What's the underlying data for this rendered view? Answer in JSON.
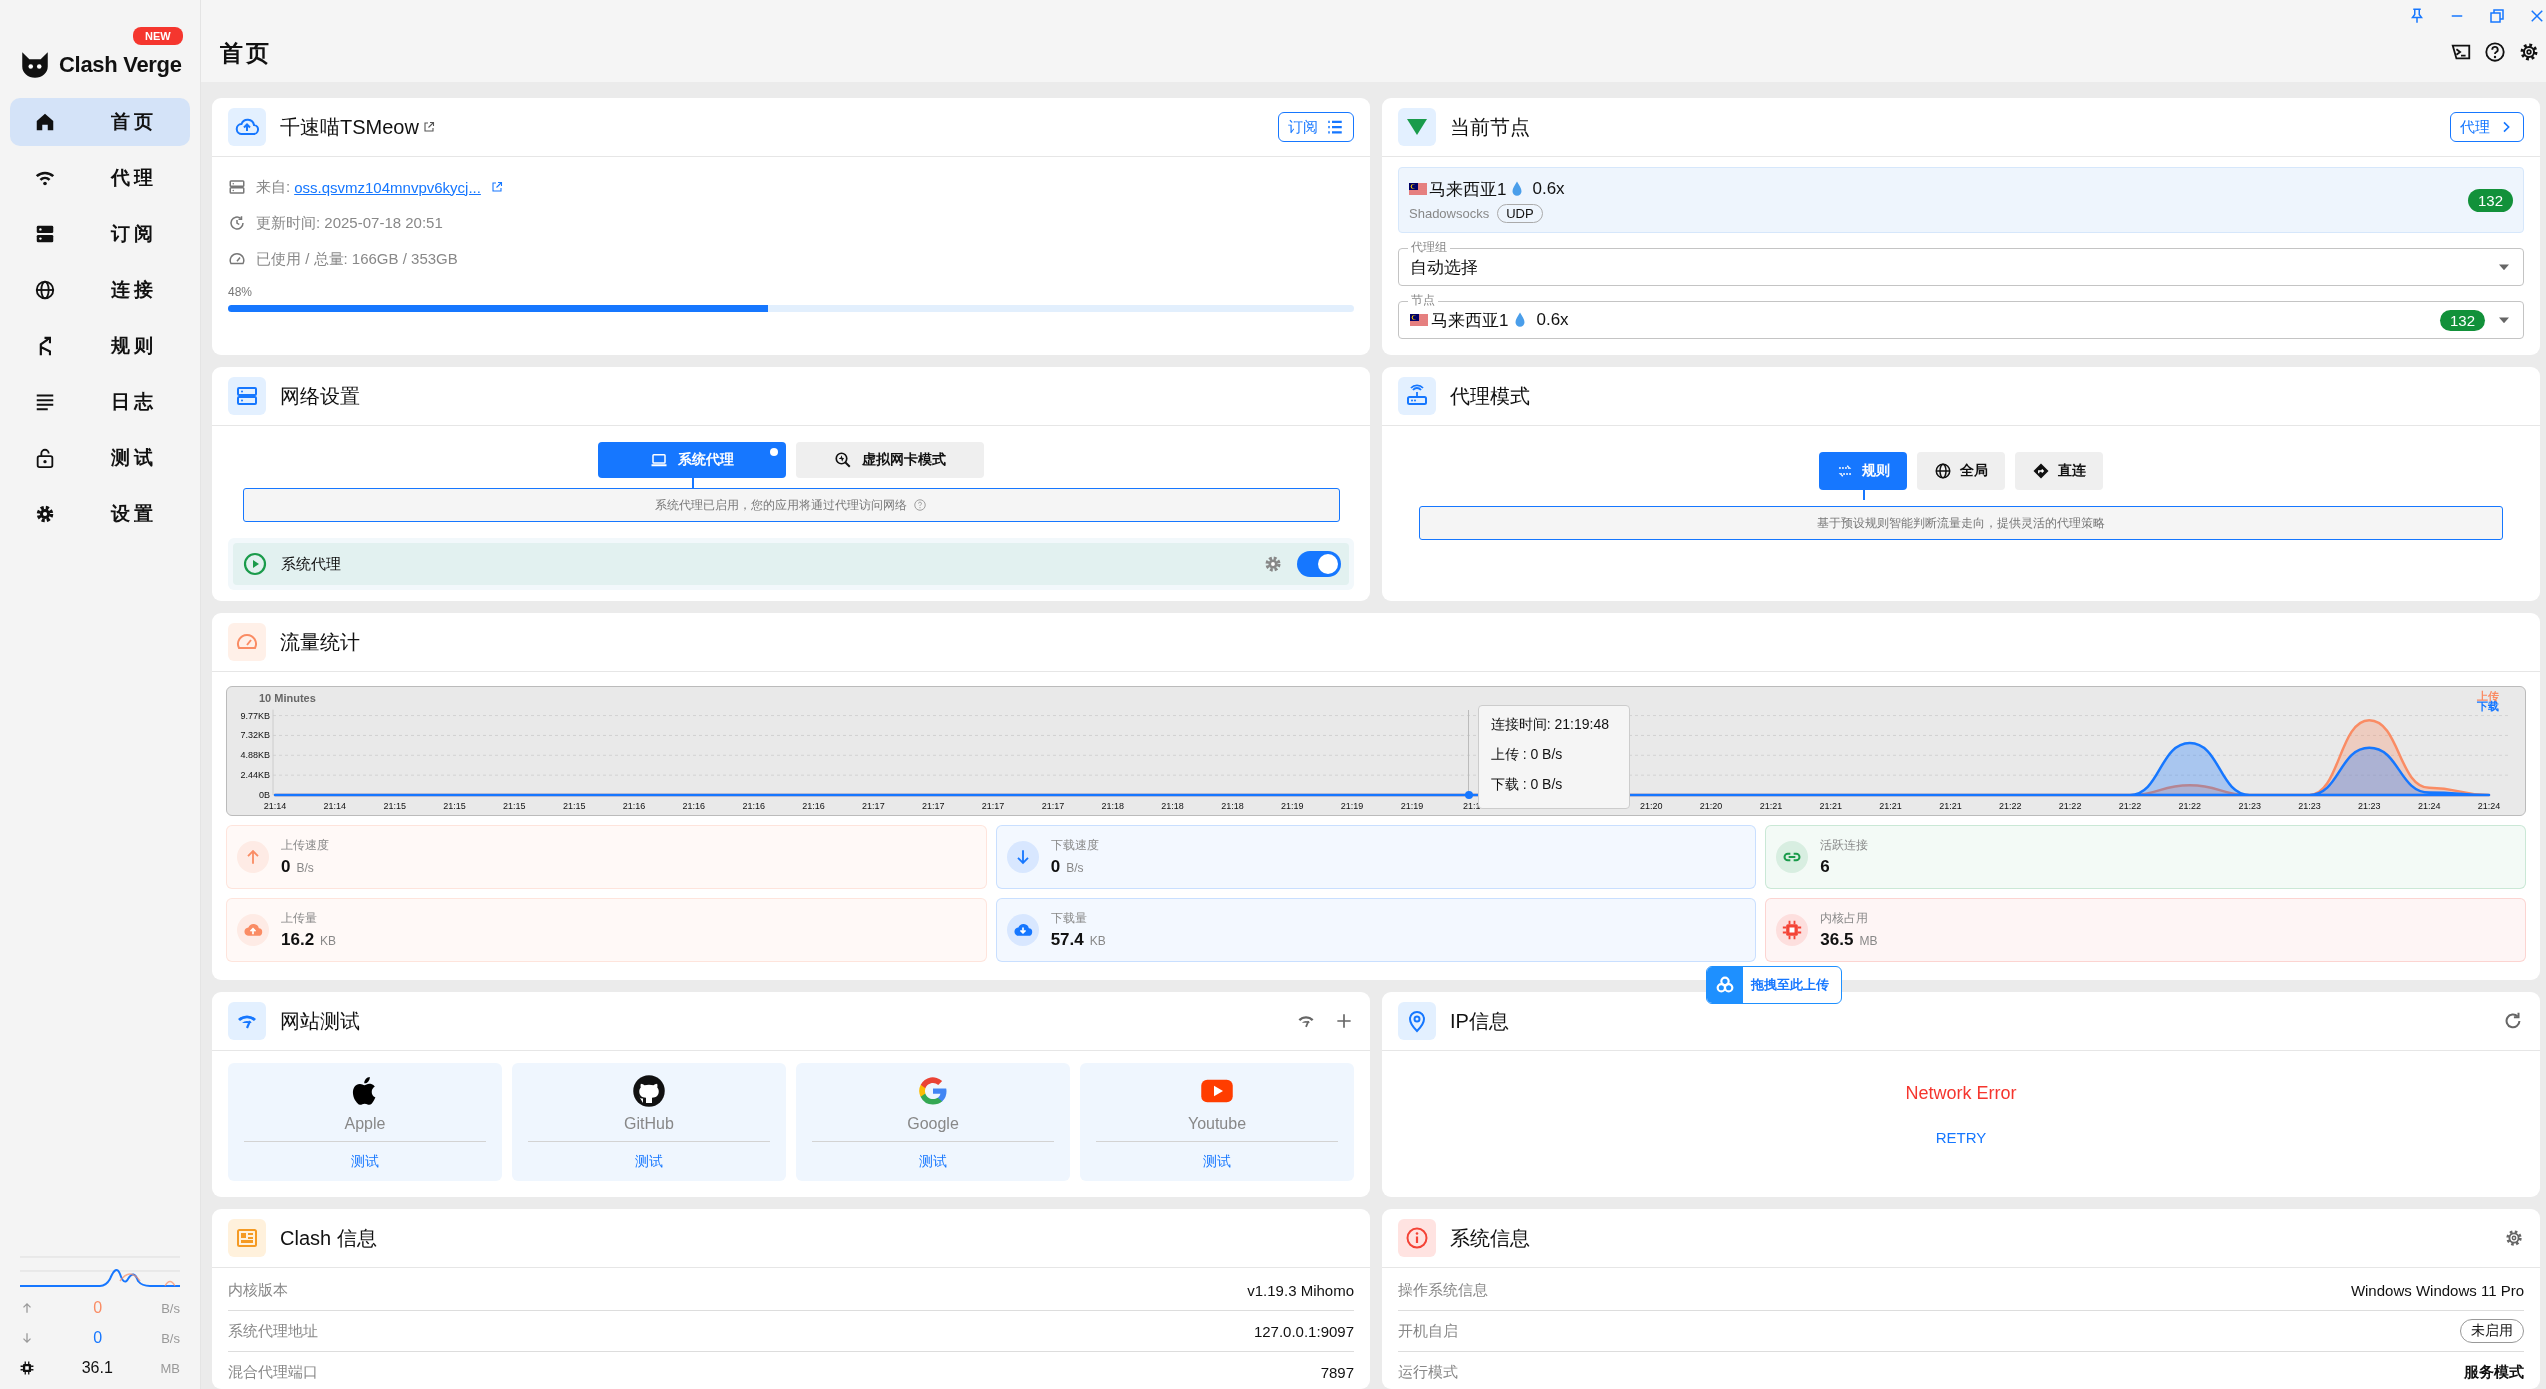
{
  "sidebar": {
    "logo": "Clash Verge",
    "badge": "NEW",
    "items": [
      {
        "label": "首页",
        "selected": true
      },
      {
        "label": "代理",
        "selected": false
      },
      {
        "label": "订阅",
        "selected": false
      },
      {
        "label": "连接",
        "selected": false
      },
      {
        "label": "规则",
        "selected": false
      },
      {
        "label": "日志",
        "selected": false
      },
      {
        "label": "测试",
        "selected": false
      },
      {
        "label": "设置",
        "selected": false
      }
    ],
    "traffic": [
      {
        "value": "0",
        "unit": "B/s"
      },
      {
        "value": "0",
        "unit": "B/s"
      },
      {
        "value": "36.1",
        "unit": "MB"
      }
    ]
  },
  "header": {
    "title": "首页"
  },
  "profile": {
    "name": "千速喵TSMeow",
    "button": "订阅",
    "source_label": "来自: ",
    "source_link": "oss.qsvmz104mnvpv6kycj...",
    "updated": "更新时间: 2025-07-18 20:51",
    "usage": "已使用 / 总量: 166GB / 353GB",
    "percent": "48%",
    "level": 0.48
  },
  "current_node": {
    "title": "当前节点",
    "button": "代理",
    "node": {
      "name": "马来西亚1",
      "rate": "0.6x",
      "protocol": "Shadowsocks",
      "tag": "UDP",
      "delay": "132"
    },
    "group": {
      "label": "代理组",
      "value": "自动选择"
    },
    "node_select": {
      "label": "节点",
      "name": "马来西亚1",
      "rate": "0.6x",
      "delay": "132"
    }
  },
  "network": {
    "title": "网络设置",
    "tabs": [
      {
        "label": "系统代理",
        "selected": true,
        "indicator": true
      },
      {
        "label": "虚拟网卡模式",
        "selected": false,
        "indicator": false
      }
    ],
    "hint": "系统代理已启用，您的应用将通过代理访问网络",
    "switch": {
      "label": "系统代理",
      "on": true
    }
  },
  "proxy_mode": {
    "title": "代理模式",
    "modes": [
      {
        "label": "规则",
        "selected": true
      },
      {
        "label": "全局",
        "selected": false
      },
      {
        "label": "直连",
        "selected": false
      }
    ],
    "hint": "基于预设规则智能判断流量走向，提供灵活的代理策略"
  },
  "traffic": {
    "title": "流量统计",
    "chart_data": {
      "type": "area",
      "title": "10 Minutes",
      "categories": [
        "21:14",
        "21:14",
        "21:15",
        "21:15",
        "21:15",
        "21:15",
        "21:16",
        "21:16",
        "21:16",
        "21:16",
        "21:17",
        "21:17",
        "21:17",
        "21:17",
        "21:18",
        "21:18",
        "21:18",
        "21:19",
        "21:19",
        "21:19",
        "21:1",
        null,
        null,
        "21:20",
        "21:20",
        "21:21",
        "21:21",
        "21:21",
        "21:21",
        "21:22",
        "21:22",
        "21:22",
        "21:22",
        "21:23",
        "21:23",
        "21:23",
        "21:24",
        "21:24"
      ],
      "series": [
        {
          "name": "上传",
          "color": "#fa8c64",
          "values": [
            0,
            0,
            0,
            0,
            0,
            0,
            0,
            0,
            0,
            0,
            0,
            0,
            0,
            0,
            0,
            0,
            0,
            0,
            0,
            0,
            0,
            null,
            null,
            0,
            0,
            0,
            0,
            0,
            0,
            0,
            0,
            0,
            1.2,
            0,
            0,
            9.2,
            0.9,
            0
          ]
        },
        {
          "name": "下载",
          "color": "#1677ff",
          "values": [
            0,
            0,
            0,
            0,
            0,
            0,
            0,
            0,
            0,
            0,
            0,
            0,
            0,
            0,
            0,
            0,
            0,
            0,
            0,
            0,
            0,
            null,
            null,
            0,
            0,
            0,
            0,
            0,
            0,
            0,
            0,
            0,
            6.4,
            0,
            0,
            5.8,
            0.3,
            0
          ]
        }
      ],
      "ylim": [
        0,
        10.5
      ],
      "grid": true,
      "ref_lines": [
        {
          "axis": "x",
          "value": "21:1",
          "color": "#bbbbbb"
        }
      ],
      "yticks": [
        {
          "value": 0,
          "label": "0B"
        },
        {
          "value": 2.44,
          "label": "2.44KB"
        },
        {
          "value": 4.88,
          "label": "4.88KB"
        },
        {
          "value": 7.32,
          "label": "7.32KB"
        },
        {
          "value": 9.77,
          "label": "9.77KB"
        }
      ]
    },
    "tooltip": {
      "title": "连接时间: 21:19:48",
      "lines": [
        "上传 : 0 B/s",
        "下载 : 0 B/s"
      ]
    },
    "stats": [
      {
        "label": "上传速度",
        "value": "0",
        "unit": "B/s",
        "color": "#fa8c64"
      },
      {
        "label": "下载速度",
        "value": "0",
        "unit": "B/s",
        "color": "#1677ff"
      },
      {
        "label": "活跃连接",
        "value": "6",
        "color": "#1a9b4b"
      },
      {
        "label": "上传量",
        "value": "16.2",
        "unit": "KB",
        "color": "#fa8c64"
      },
      {
        "label": "下载量",
        "value": "57.4",
        "unit": "KB",
        "color": "#1677ff"
      },
      {
        "label": "内核占用",
        "value": "36.5",
        "unit": "MB",
        "color": "#f44336"
      }
    ]
  },
  "site_test": {
    "title": "网站测试",
    "sites": [
      {
        "name": "Apple",
        "action": "测试"
      },
      {
        "name": "GitHub",
        "action": "测试"
      },
      {
        "name": "Google",
        "action": "测试"
      },
      {
        "name": "Youtube",
        "action": "测试"
      }
    ]
  },
  "ip_info": {
    "title": "IP信息",
    "error": "Network Error",
    "retry": "RETRY"
  },
  "clash_info": {
    "title": "Clash 信息",
    "rows": [
      {
        "label": "内核版本",
        "value": "v1.19.3 Mihomo"
      },
      {
        "label": "系统代理地址",
        "value": "127.0.0.1:9097"
      },
      {
        "label": "混合代理端口",
        "value": "7897"
      }
    ]
  },
  "system_info": {
    "title": "系统信息",
    "rows": [
      {
        "label": "操作系统信息",
        "value": "Windows Windows 11 Pro",
        "kind": "text"
      },
      {
        "label": "开机自启",
        "value": "未启用",
        "kind": "chip"
      },
      {
        "label": "运行模式",
        "value": "服务模式",
        "kind": "bold"
      }
    ]
  },
  "drop_badge": {
    "label": "拖拽至此上传"
  }
}
